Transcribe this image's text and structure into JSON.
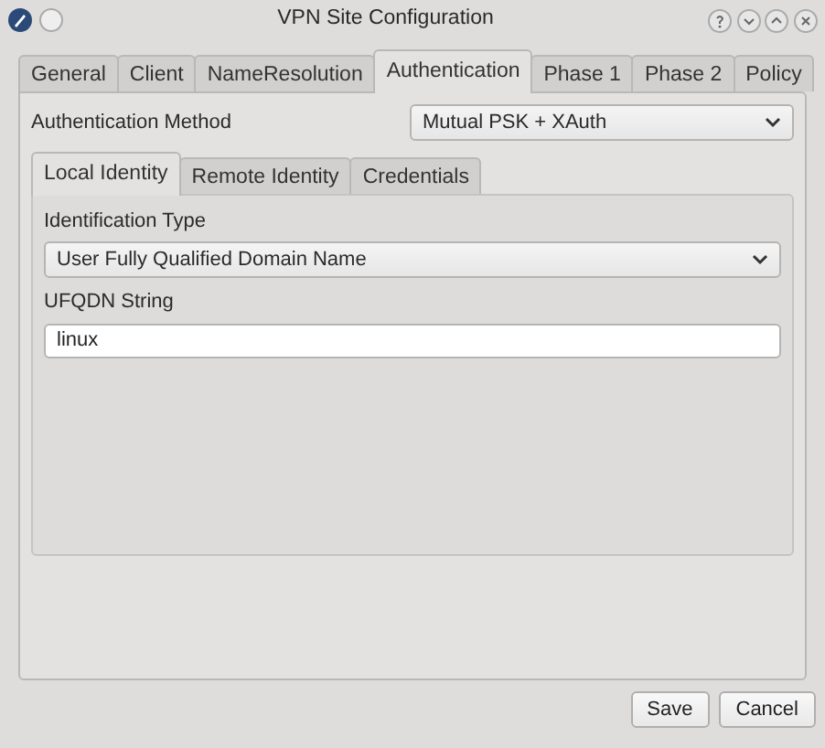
{
  "window": {
    "title": "VPN Site Configuration"
  },
  "tabs": [
    {
      "label": "General",
      "selected": false
    },
    {
      "label": "Client",
      "selected": false
    },
    {
      "label": "NameResolution",
      "selected": false
    },
    {
      "label": "Authentication",
      "selected": true
    },
    {
      "label": "Phase 1",
      "selected": false
    },
    {
      "label": "Phase 2",
      "selected": false
    },
    {
      "label": "Policy",
      "selected": false
    }
  ],
  "authentication_method": {
    "label": "Authentication Method",
    "value": "Mutual PSK + XAuth"
  },
  "sub_tabs": [
    {
      "label": "Local Identity",
      "selected": true
    },
    {
      "label": "Remote Identity",
      "selected": false
    },
    {
      "label": "Credentials",
      "selected": false
    }
  ],
  "identification_type": {
    "label": "Identification Type",
    "value": "User Fully Qualified Domain Name"
  },
  "ufqdn_string": {
    "label": "UFQDN String",
    "value": "linux"
  },
  "buttons": [
    "Save",
    "Cancel"
  ]
}
